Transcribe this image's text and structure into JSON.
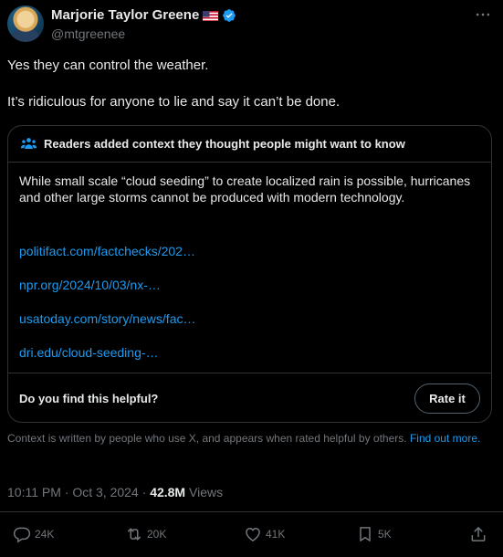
{
  "author": {
    "display_name": "Marjorie Taylor Greene",
    "handle": "@mtgreenee",
    "flag_icon": "us-flag-icon",
    "verified_icon": "verified-badge-icon"
  },
  "tweet": {
    "paragraphs": [
      "Yes they can control the weather.",
      "It’s ridiculous for anyone to lie and say it can’t be done."
    ]
  },
  "community_note": {
    "title": "Readers added context they thought people might want to know",
    "body": "While small scale “cloud seeding” to create localized rain is possible, hurricanes and other large storms cannot be produced with modern technology.",
    "links": [
      "politifact.com/factchecks/202…",
      "npr.org/2024/10/03/nx-…",
      "usatoday.com/story/news/fac…",
      "dri.edu/cloud-seeding-…"
    ],
    "helpful_question": "Do you find this helpful?",
    "rate_button": "Rate it"
  },
  "context_disclaimer": {
    "text": "Context is written by people who use X, and appears when rated helpful by others.",
    "link": "Find out more."
  },
  "meta": {
    "time": "10:11 PM",
    "separator": " · ",
    "date": "Oct 3, 2024",
    "views_count": "42.8M",
    "views_label": "Views"
  },
  "actions": {
    "replies": "24K",
    "reposts": "20K",
    "likes": "41K",
    "bookmarks": "5K"
  },
  "colors": {
    "background": "#000000",
    "text": "#e7e9ea",
    "muted": "#71767b",
    "link": "#1d9bf0",
    "border": "#2f3336"
  }
}
